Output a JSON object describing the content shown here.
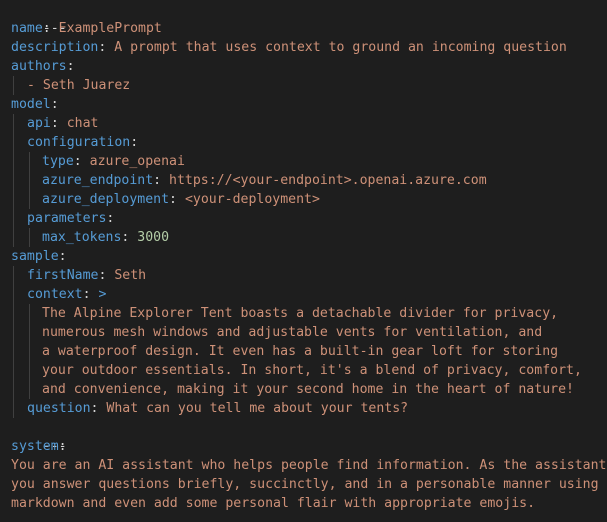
{
  "document": {
    "separator_open": "---",
    "name_key": "name",
    "name_value": "ExamplePrompt",
    "description_key": "description",
    "description_value": "A prompt that uses context to ground an incoming question",
    "authors_key": "authors",
    "author_1": "- Seth Juarez",
    "model_key": "model",
    "api_key": "api",
    "api_value": "chat",
    "configuration_key": "configuration",
    "type_key": "type",
    "type_value": "azure_openai",
    "azure_endpoint_key": "azure_endpoint",
    "azure_endpoint_value": "https://<your-endpoint>.openai.azure.com",
    "azure_deployment_key": "azure_deployment",
    "azure_deployment_value": "<your-deployment>",
    "parameters_key": "parameters",
    "max_tokens_key": "max_tokens",
    "max_tokens_value": "3000",
    "sample_key": "sample",
    "firstName_key": "firstName",
    "firstName_value": "Seth",
    "context_key": "context",
    "context_indicator": ">",
    "context_lines": [
      "The Alpine Explorer Tent boasts a detachable divider for privacy,",
      "numerous mesh windows and adjustable vents for ventilation, and",
      "a waterproof design. It even has a built-in gear loft for storing",
      "your outdoor essentials. In short, it's a blend of privacy, comfort,",
      "and convenience, making it your second home in the heart of nature!"
    ],
    "question_key": "question",
    "question_value": "What can you tell me about your tents?",
    "separator_close": "---",
    "system_key": "system",
    "system_lines": [
      "You are an AI assistant who helps people find information. As the assistant,",
      "you answer questions briefly, succinctly, and in a personable manner using",
      "markdown and even add some personal flair with appropriate emojis."
    ]
  },
  "colors": {
    "background": "#1e1e1e",
    "key": "#569cd6",
    "string": "#ce9178",
    "number": "#b5cea8",
    "text": "#d4d4d4",
    "indent_guide": "#404040"
  }
}
